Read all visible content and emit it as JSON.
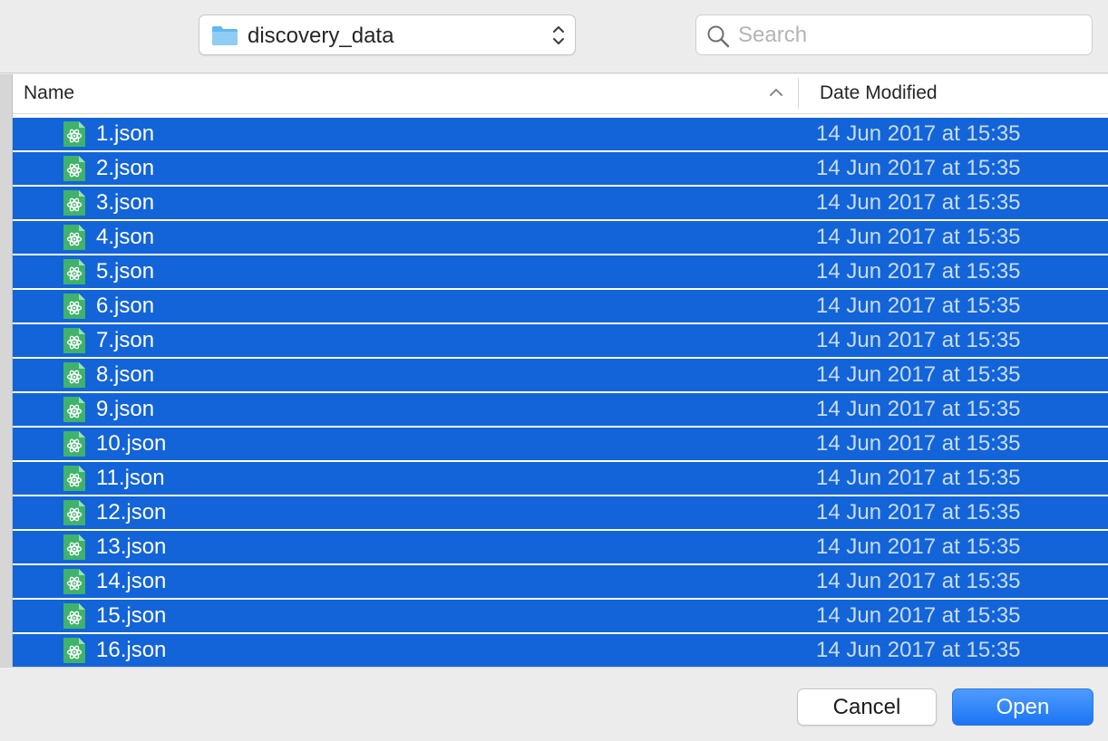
{
  "toolbar": {
    "location_label": "discovery_data",
    "folder_icon": "folder-icon",
    "search_placeholder": "Search",
    "search_value": ""
  },
  "columns": {
    "name_label": "Name",
    "date_label": "Date Modified",
    "sort": "ascending"
  },
  "files": [
    {
      "name": "1.json",
      "date": "14 Jun 2017 at 15:35"
    },
    {
      "name": "2.json",
      "date": "14 Jun 2017 at 15:35"
    },
    {
      "name": "3.json",
      "date": "14 Jun 2017 at 15:35"
    },
    {
      "name": "4.json",
      "date": "14 Jun 2017 at 15:35"
    },
    {
      "name": "5.json",
      "date": "14 Jun 2017 at 15:35"
    },
    {
      "name": "6.json",
      "date": "14 Jun 2017 at 15:35"
    },
    {
      "name": "7.json",
      "date": "14 Jun 2017 at 15:35"
    },
    {
      "name": "8.json",
      "date": "14 Jun 2017 at 15:35"
    },
    {
      "name": "9.json",
      "date": "14 Jun 2017 at 15:35"
    },
    {
      "name": "10.json",
      "date": "14 Jun 2017 at 15:35"
    },
    {
      "name": "11.json",
      "date": "14 Jun 2017 at 15:35"
    },
    {
      "name": "12.json",
      "date": "14 Jun 2017 at 15:35"
    },
    {
      "name": "13.json",
      "date": "14 Jun 2017 at 15:35"
    },
    {
      "name": "14.json",
      "date": "14 Jun 2017 at 15:35"
    },
    {
      "name": "15.json",
      "date": "14 Jun 2017 at 15:35"
    },
    {
      "name": "16.json",
      "date": "14 Jun 2017 at 15:35"
    }
  ],
  "selection": {
    "all_selected": true,
    "highlight_color": "#1364d8"
  },
  "buttons": {
    "cancel_label": "Cancel",
    "open_label": "Open"
  },
  "colors": {
    "accent": "#1b75f3",
    "file_icon": "#3fb26b"
  }
}
